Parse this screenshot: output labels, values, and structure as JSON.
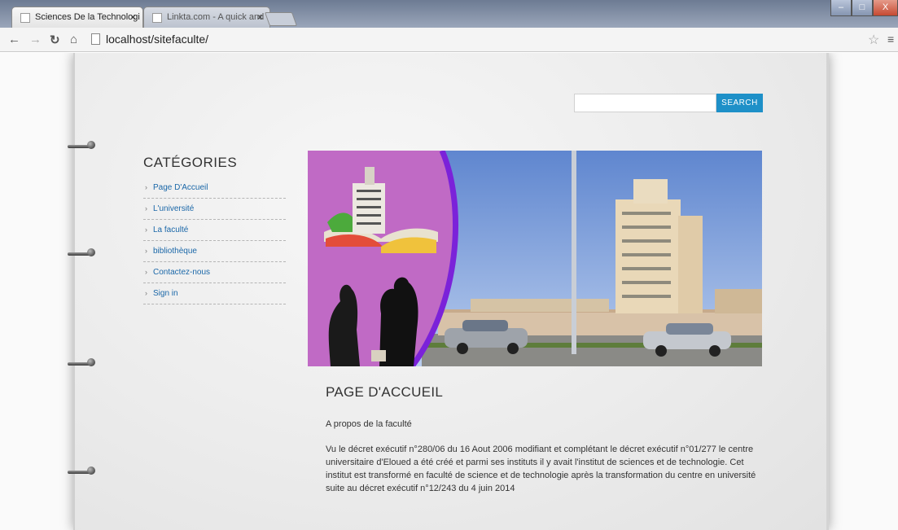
{
  "browser": {
    "tabs": [
      {
        "label": "Sciences De la Technologi"
      },
      {
        "label": "Linkta.com - A quick and"
      }
    ],
    "close_glyph": "×",
    "url": "localhost/sitefaculte/",
    "window_controls": {
      "minimize": "–",
      "maximize": "□",
      "close": "X"
    }
  },
  "search": {
    "button_label": "SEARCH",
    "placeholder": "",
    "accent": "#1e90c8"
  },
  "sidebar": {
    "title": "CATÉGORIES",
    "items": [
      {
        "label": "Page D'Accueil"
      },
      {
        "label": "L'université"
      },
      {
        "label": "La faculté"
      },
      {
        "label": "bibliothèque"
      },
      {
        "label": "Contactez-nous"
      },
      {
        "label": "Sign in"
      }
    ]
  },
  "main": {
    "heading": "PAGE D'ACCUEIL",
    "subheading": "A propos de la faculté",
    "body": "Vu le décret exécutif n°280/06 du 16 Aout 2006 modifiant et complétant le décret exécutif n°01/277 le centre universitaire d'Eloued a été créé et parmi ses instituts il y avait l'institut de sciences et de technologie. Cet institut est transformé en faculté de science et de technologie après la transformation du centre en université suite au décret exécutif n°12/243 du 4 juin 2014"
  }
}
